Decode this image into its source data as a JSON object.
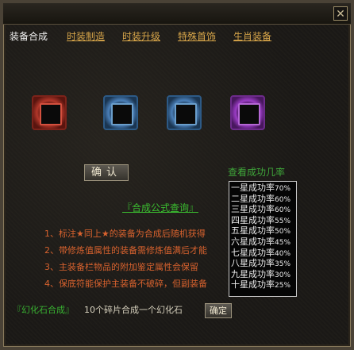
{
  "window": {
    "close_symbol": "✕"
  },
  "tabs": [
    {
      "label": "装备合成",
      "active": true
    },
    {
      "label": "时装制造",
      "active": false
    },
    {
      "label": "时装升级",
      "active": false
    },
    {
      "label": "特殊首饰",
      "active": false
    },
    {
      "label": "生肖装备",
      "active": false
    }
  ],
  "slots": [
    {
      "name": "red-slot",
      "color": "#b2372a"
    },
    {
      "name": "blue-slot-1",
      "color": "#4a7fb8"
    },
    {
      "name": "blue-slot-2",
      "color": "#4a7fb8"
    },
    {
      "name": "purple-slot",
      "color": "#9a3cc4"
    }
  ],
  "confirm_label": "确认",
  "view_rate_label": "查看成功几率",
  "rates": [
    {
      "label": "一星成功率",
      "value": "70%"
    },
    {
      "label": "二星成功率",
      "value": "60%"
    },
    {
      "label": "三星成功率",
      "value": "60%"
    },
    {
      "label": "四星成功率",
      "value": "55%"
    },
    {
      "label": "五星成功率",
      "value": "50%"
    },
    {
      "label": "六星成功率",
      "value": "45%"
    },
    {
      "label": "七星成功率",
      "value": "40%"
    },
    {
      "label": "八星成功率",
      "value": "35%"
    },
    {
      "label": "九星成功率",
      "value": "30%"
    },
    {
      "label": "十星成功率",
      "value": "25%"
    }
  ],
  "formula_link": "『合成公式查询』",
  "notes": [
    "1、标注★同上★的装备为合成后随机获得",
    "2、带修炼值属性的装备需修炼值满后才能",
    "3、主装备栏物品的附加鉴定属性会保留",
    "4、保底符能保护主装备不破碎，但副装备"
  ],
  "bottom": {
    "label": "『幻化石合成』",
    "desc": "10个碎片合成一个幻化石",
    "ok_label": "确定"
  },
  "colors": {
    "accent_green": "#3bbf30",
    "tab_inactive": "#d8a64a",
    "note_orange": "#d8622e"
  }
}
